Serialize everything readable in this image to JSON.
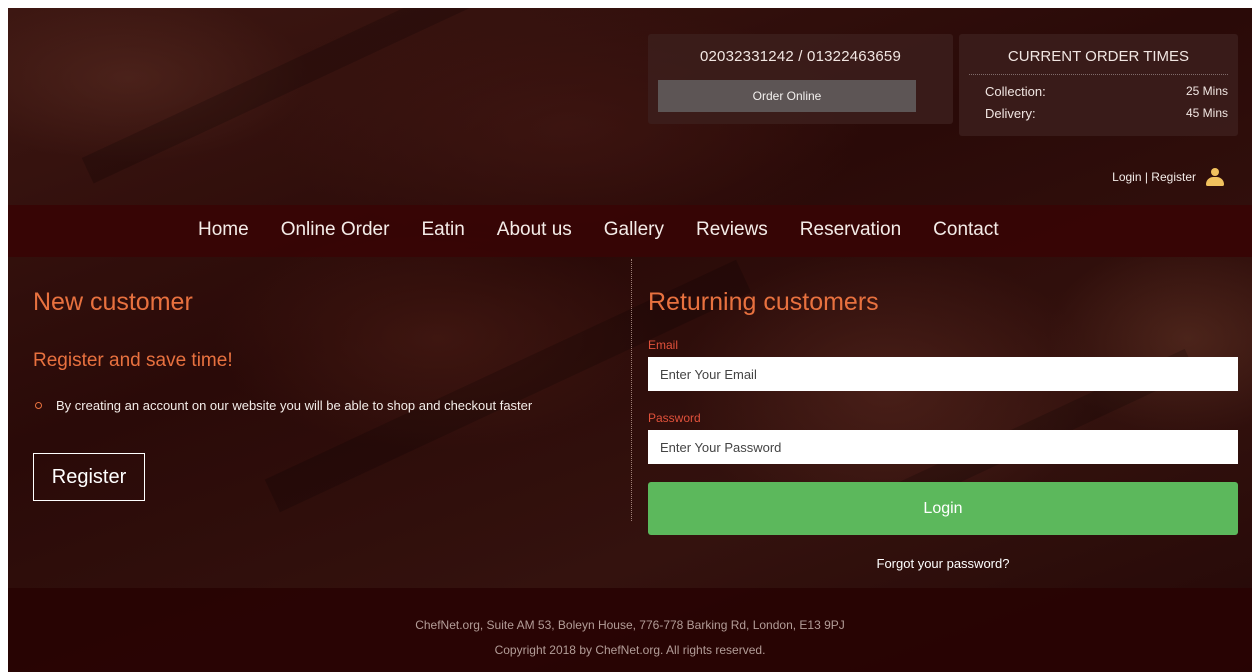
{
  "header": {
    "phone_numbers": "02032331242 / 01322463659",
    "order_online_label": "Order Online",
    "order_times": {
      "title": "CURRENT ORDER TIMES",
      "collection_label": "Collection:",
      "collection_value": "25 Mins",
      "delivery_label": "Delivery:",
      "delivery_value": "45 Mins"
    },
    "auth_label": "Login | Register",
    "user_icon": "user-icon"
  },
  "nav": {
    "items": [
      "Home",
      "Online Order",
      "Eatin",
      "About us",
      "Gallery",
      "Reviews",
      "Reservation",
      "Contact"
    ]
  },
  "new_customer": {
    "title": "New customer",
    "subtitle": "Register and save time!",
    "benefit": "By creating an account on our website you will be able to shop and checkout faster",
    "register_label": "Register"
  },
  "returning_customers": {
    "title": "Returning customers",
    "email_label": "Email",
    "email_placeholder": "Enter Your Email",
    "password_label": "Password",
    "password_placeholder": "Enter Your Password",
    "login_label": "Login",
    "forgot_label": "Forgot your password?"
  },
  "footer": {
    "address": "ChefNet.org, Suite AM 53, Boleyn House, 776-778 Barking Rd, London, E13 9PJ",
    "copyright": "Copyright 2018 by ChefNet.org. All rights reserved."
  },
  "colors": {
    "accent": "#e8713f",
    "login_button": "#5cb85c",
    "nav_bar": "#370505",
    "label_red": "#e0513b"
  }
}
